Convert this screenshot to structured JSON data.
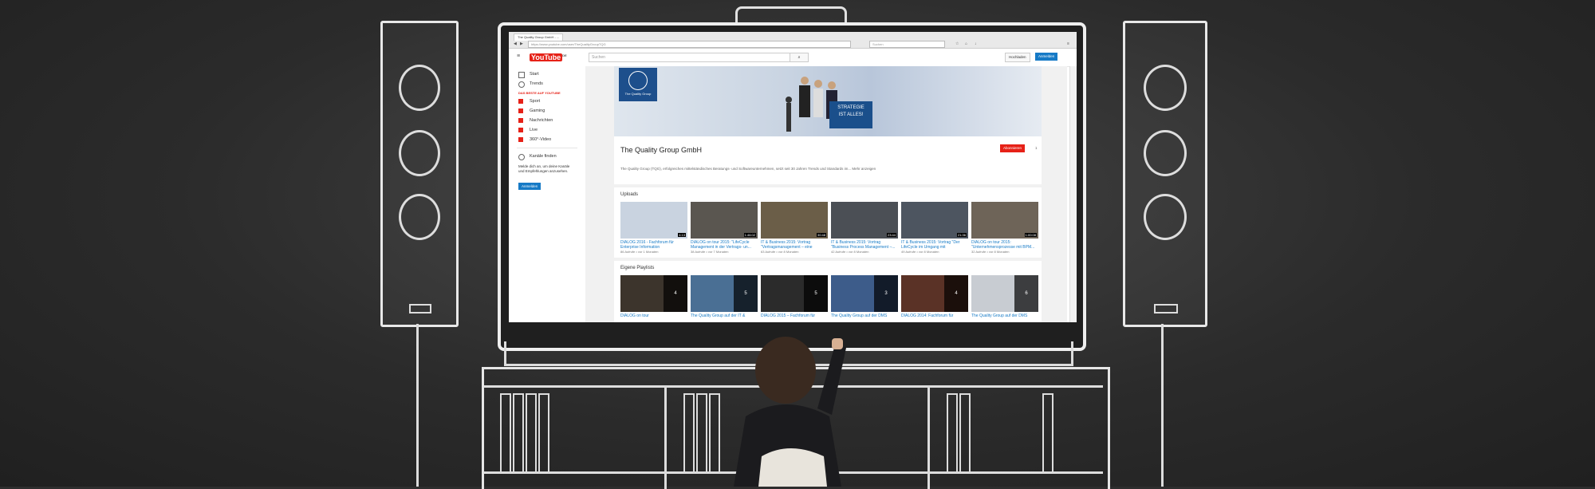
{
  "browser": {
    "tab_title": "The Quality Group GmbH - ...",
    "url": "https://www.youtube.com/user/TheQualityGroupTQG",
    "search_placeholder": "Suchen"
  },
  "youtube": {
    "logo": "YouTube",
    "logo_suffix": "DE",
    "search_placeholder": "Suchen",
    "upload_label": "Hochladen",
    "signin_label": "Anmelden"
  },
  "sidebar": {
    "items": [
      {
        "label": "Start",
        "icon": "home-icon"
      },
      {
        "label": "Trends",
        "icon": "flame-icon"
      }
    ],
    "section_heading": "DAS BESTE AUF YOUTUBE",
    "best_items": [
      {
        "label": "Sport",
        "color": "#e62117"
      },
      {
        "label": "Gaming",
        "color": "#e62117"
      },
      {
        "label": "Nachrichten",
        "color": "#e62117"
      },
      {
        "label": "Live",
        "color": "#e62117"
      },
      {
        "label": "360°-Video",
        "color": "#e62117"
      }
    ],
    "browse_channels": "Kanäle finden",
    "signin_note": "Melde dich an, um deine Kanäle und Empfehlungen anzusehen.",
    "signin_button": "Anmelden"
  },
  "channel": {
    "logo_text": "The Quality Group",
    "banner_tagline_1": "STRATEGIE",
    "banner_tagline_2": "IST ALLES!",
    "name": "The Quality Group GmbH",
    "subscribe_label": "Abonnieren",
    "subscriber_count": "1",
    "description": "The Quality Group (TQG), erfolgreiches mittelständisches Beratungs- und Softwareunternehmen, setzt seit 30 Jahren Trends und Standards im... Mehr anzeigen"
  },
  "uploads": {
    "title": "Uploads",
    "videos": [
      {
        "title": "DIALOG 2016 - Fachforum für Enterprise Information",
        "meta": "86 Aufrufe • vor 1 Monaten",
        "duration": "4:13"
      },
      {
        "title": "DIALOG on tour 2015: \"LifeCycle Management in der Vertrags- un...",
        "meta": "38 Aufrufe • vor 7 Monaten",
        "duration": "1:46:02"
      },
      {
        "title": "IT & Business 2015: Vortrag \"Vertragsmanagement – eine",
        "meta": "63 Aufrufe • vor 8 Monaten",
        "duration": "30:48"
      },
      {
        "title": "IT & Business 2015: Vortrag \"Business Process Management –...",
        "meta": "42 Aufrufe • vor 8 Monaten",
        "duration": "23:44"
      },
      {
        "title": "IT & Business 2015: Vortrag \"Der LifeCycle im Umgang mit",
        "meta": "49 Aufrufe • vor 8 Monaten",
        "duration": "21:36"
      },
      {
        "title": "DIALOG on tour 2015: \"Unternehmensprozesse mit BPM...",
        "meta": "32 Aufrufe • vor 8 Monaten",
        "duration": "1:00:08"
      }
    ]
  },
  "playlists": {
    "title": "Eigene Playlists",
    "items": [
      {
        "title": "DIALOG on tour",
        "count": "4"
      },
      {
        "title": "The Quality Group auf der IT &",
        "count": "5"
      },
      {
        "title": "DIALOG 2015 – Fachforum für",
        "count": "5"
      },
      {
        "title": "The Quality Group auf der DMS",
        "count": "3"
      },
      {
        "title": "DIALOG 2014: Fachforum für",
        "count": "4"
      },
      {
        "title": "The Quality Group auf der DMS",
        "count": "6"
      }
    ]
  },
  "colors": {
    "brand_red": "#e62117",
    "link_blue": "#167ac6",
    "chalkboard": "#2e2e2e"
  }
}
